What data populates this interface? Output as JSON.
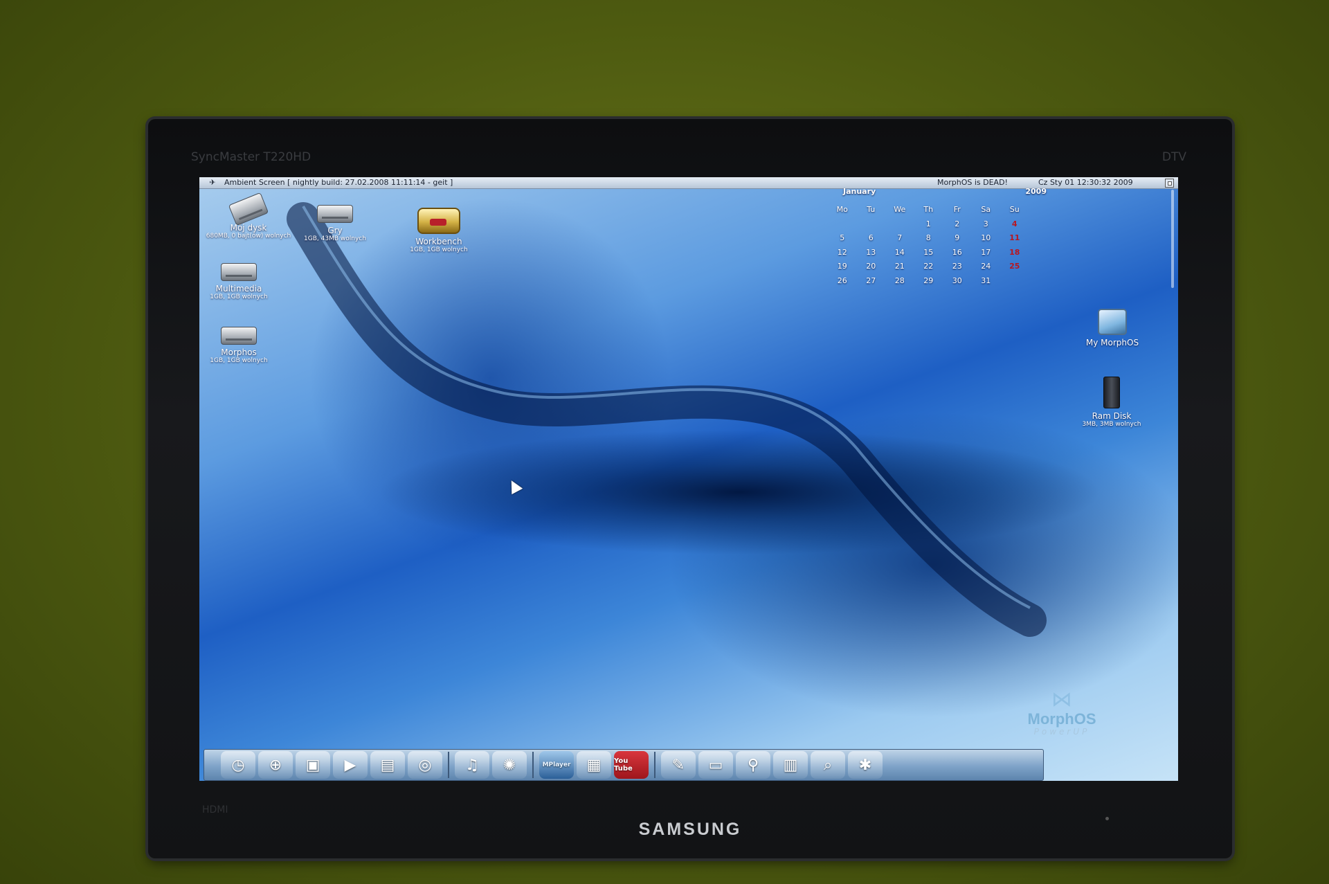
{
  "monitor": {
    "brand": "SAMSUNG",
    "model_label": "SyncMaster T220HD",
    "dtv_label": "DTV",
    "hdmi_label": "HDMI"
  },
  "titlebar": {
    "logo_icon": "morphos-butterfly-icon",
    "title": "Ambient Screen  [ nightly build: 27.02.2008 11:11:14 - geit ]",
    "status": "MorphOS is DEAD!",
    "clock": "Cz Sty 01 12:30:32 2009"
  },
  "desktop_icons": [
    {
      "name": "Mój dysk",
      "info": "680MB, 0 bajt(ów) wolnych",
      "icon": "hard-disk-icon"
    },
    {
      "name": "Gry",
      "info": "1GB, 43MB wolnych",
      "icon": "drive-icon"
    },
    {
      "name": "Workbench",
      "info": "1GB, 1GB wolnych",
      "icon": "workbench-drive-icon"
    },
    {
      "name": "Multimedia",
      "info": "1GB, 1GB wolnych",
      "icon": "drive-icon"
    },
    {
      "name": "Morphos",
      "info": "1GB, 1GB wolnych",
      "icon": "drive-icon"
    },
    {
      "name": "My MorphOS",
      "info": "",
      "icon": "my-morphos-icon"
    },
    {
      "name": "Ram Disk",
      "info": "3MB, 3MB wolnych",
      "icon": "ram-disk-icon"
    }
  ],
  "calendar": {
    "month": "January",
    "year": "2009",
    "weekdays": [
      "Mo",
      "Tu",
      "We",
      "Th",
      "Fr",
      "Sa",
      "Su"
    ],
    "weeks": [
      [
        "",
        "",
        "",
        "1",
        "2",
        "3",
        "4"
      ],
      [
        "5",
        "6",
        "7",
        "8",
        "9",
        "10",
        "11"
      ],
      [
        "12",
        "13",
        "14",
        "15",
        "16",
        "17",
        "18"
      ],
      [
        "19",
        "20",
        "21",
        "22",
        "23",
        "24",
        "25"
      ],
      [
        "26",
        "27",
        "28",
        "29",
        "30",
        "31",
        ""
      ]
    ]
  },
  "logo": {
    "wordmark": "MorphOS",
    "tagline": "PowerUP"
  },
  "dock": {
    "items": [
      {
        "icon": "clock-icon",
        "glyph": "◷"
      },
      {
        "icon": "globe-search-icon",
        "glyph": "⊕"
      },
      {
        "icon": "video-player-icon",
        "glyph": "▣"
      },
      {
        "icon": "media-play-icon",
        "glyph": "▶"
      },
      {
        "icon": "drive-icon",
        "glyph": "▤"
      },
      {
        "icon": "cd-icon",
        "glyph": "◎"
      },
      {
        "icon": "headphones-icon",
        "glyph": "♫"
      },
      {
        "icon": "radio-icon",
        "glyph": "✺"
      },
      {
        "icon": "mplayer-icon",
        "glyph": "MPlayer"
      },
      {
        "icon": "clapperboard-icon",
        "glyph": "▦"
      },
      {
        "icon": "youtube-icon",
        "glyph": "You Tube"
      },
      {
        "icon": "paint-icon",
        "glyph": "✎"
      },
      {
        "icon": "screen-grab-icon",
        "glyph": "▭"
      },
      {
        "icon": "magnifier-person-icon",
        "glyph": "⚲"
      },
      {
        "icon": "monitor-icon",
        "glyph": "▥"
      },
      {
        "icon": "search-icon",
        "glyph": "⌕"
      },
      {
        "icon": "tools-icon",
        "glyph": "✱"
      }
    ]
  }
}
